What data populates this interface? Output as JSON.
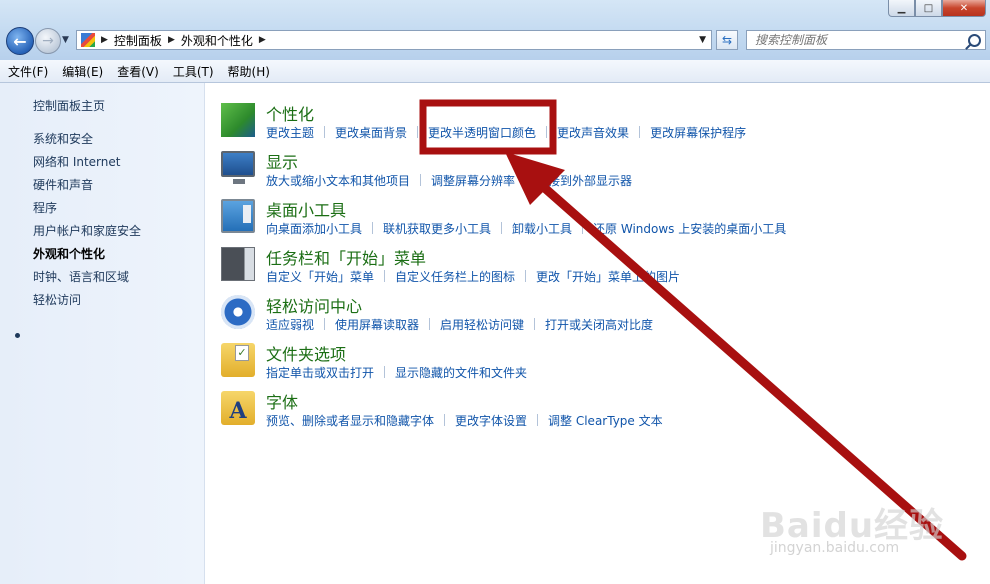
{
  "window": {
    "minimize_glyph": "▁",
    "maximize_glyph": "□",
    "close_glyph": "✕"
  },
  "address": {
    "breadcrumbs": [
      "控制面板",
      "外观和个性化"
    ]
  },
  "search": {
    "placeholder": "搜索控制面板"
  },
  "menu": {
    "items": [
      "文件(F)",
      "编辑(E)",
      "查看(V)",
      "工具(T)",
      "帮助(H)"
    ]
  },
  "sidebar": {
    "items": [
      {
        "label": "控制面板主页"
      },
      {
        "label": "系统和安全"
      },
      {
        "label": "网络和 Internet"
      },
      {
        "label": "硬件和声音"
      },
      {
        "label": "程序"
      },
      {
        "label": "用户帐户和家庭安全"
      },
      {
        "label": "外观和个性化",
        "active": true
      },
      {
        "label": "时钟、语言和区域"
      },
      {
        "label": "轻松访问"
      }
    ]
  },
  "categories": [
    {
      "title": "个性化",
      "icon": "personalization-icon",
      "links": [
        "更改主题",
        "更改桌面背景",
        "更改半透明窗口颜色",
        "更改声音效果",
        "更改屏幕保护程序"
      ]
    },
    {
      "title": "显示",
      "icon": "display-icon",
      "links": [
        "放大或缩小文本和其他项目",
        "调整屏幕分辨率",
        "连接到外部显示器"
      ]
    },
    {
      "title": "桌面小工具",
      "icon": "gadgets-icon",
      "links": [
        "向桌面添加小工具",
        "联机获取更多小工具",
        "卸载小工具",
        "还原 Windows 上安装的桌面小工具"
      ]
    },
    {
      "title": "任务栏和「开始」菜单",
      "icon": "taskbar-icon",
      "links": [
        "自定义「开始」菜单",
        "自定义任务栏上的图标",
        "更改「开始」菜单上的图片"
      ]
    },
    {
      "title": "轻松访问中心",
      "icon": "ease-of-access-icon",
      "links": [
        "适应弱视",
        "使用屏幕读取器",
        "启用轻松访问键",
        "打开或关闭高对比度"
      ]
    },
    {
      "title": "文件夹选项",
      "icon": "folder-options-icon",
      "links": [
        "指定单击或双击打开",
        "显示隐藏的文件和文件夹"
      ]
    },
    {
      "title": "字体",
      "icon": "fonts-icon",
      "links": [
        "预览、删除或者显示和隐藏字体",
        "更改字体设置",
        "调整 ClearType 文本"
      ]
    }
  ],
  "annotation": {
    "color": "#a81010",
    "watermark": "Baidu经验",
    "watermark_sub": "jingyan.baidu.com"
  }
}
